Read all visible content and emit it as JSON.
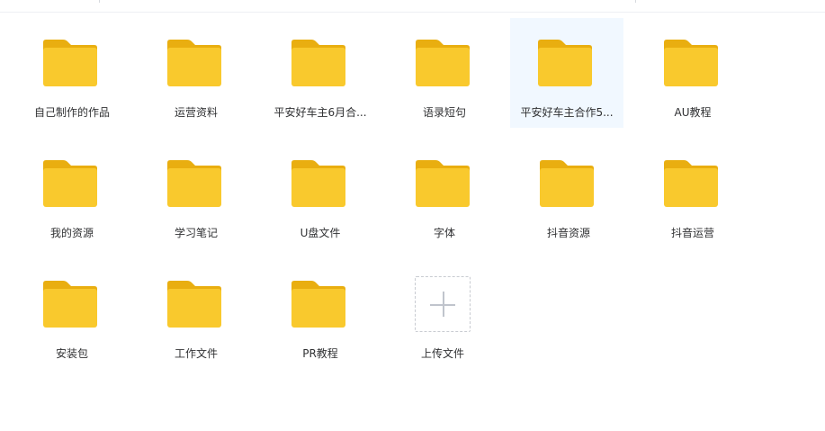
{
  "colors": {
    "folder_body": "#F9C92D",
    "folder_tab": "#E9AE10",
    "selected_bg": "#F1F8FF",
    "label_text": "#303133"
  },
  "folders": [
    {
      "name": "自己制作的作品",
      "icon": "folder-icon"
    },
    {
      "name": "运营资料",
      "icon": "folder-icon"
    },
    {
      "name": "平安好车主6月合...",
      "icon": "folder-icon"
    },
    {
      "name": "语录短句",
      "icon": "folder-icon"
    },
    {
      "name": "平安好车主合作5...",
      "icon": "folder-icon",
      "selected": true
    },
    {
      "name": "AU教程",
      "icon": "folder-icon"
    },
    {
      "name": "我的资源",
      "icon": "folder-icon"
    },
    {
      "name": "学习笔记",
      "icon": "folder-icon"
    },
    {
      "name": "U盘文件",
      "icon": "folder-icon"
    },
    {
      "name": "字体",
      "icon": "folder-icon"
    },
    {
      "name": "抖音资源",
      "icon": "folder-icon"
    },
    {
      "name": "抖音运营",
      "icon": "folder-icon"
    },
    {
      "name": "安装包",
      "icon": "folder-icon"
    },
    {
      "name": "工作文件",
      "icon": "folder-icon"
    },
    {
      "name": "PR教程",
      "icon": "folder-icon"
    }
  ],
  "upload": {
    "label": "上传文件",
    "icon": "plus-icon"
  }
}
